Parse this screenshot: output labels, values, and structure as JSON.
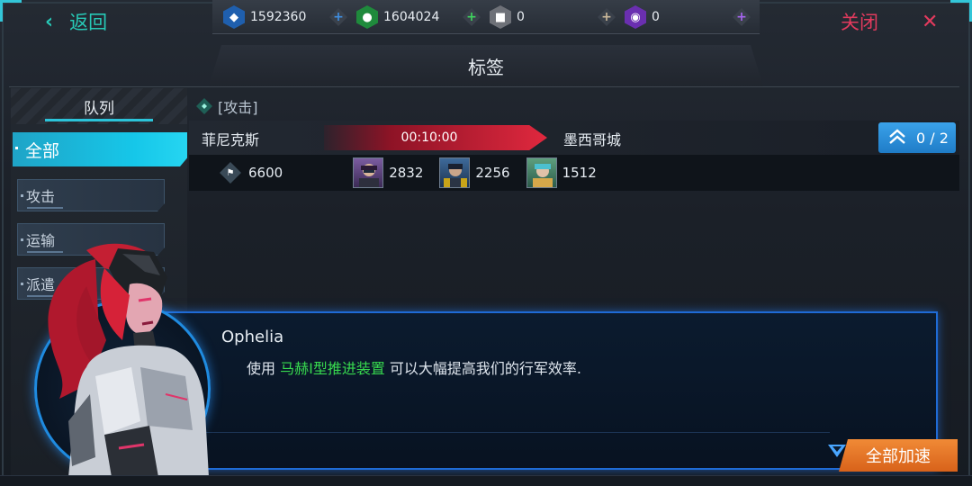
{
  "header": {
    "back_label": "返回",
    "close_label": "关闭",
    "title": "标签"
  },
  "resources": [
    {
      "icon": "crystal-icon",
      "value": "1592360",
      "color": "#2b7bd6"
    },
    {
      "icon": "water-drop-icon",
      "value": "1604024",
      "color": "#27a844"
    },
    {
      "icon": "ore-icon",
      "value": "0",
      "color": "#8b8f96"
    },
    {
      "icon": "gem-icon",
      "value": "0",
      "color": "#8a3ed6"
    }
  ],
  "sidebar": {
    "header": "队列",
    "items": [
      {
        "label": "全部",
        "active": true
      },
      {
        "label": "攻击",
        "active": false
      },
      {
        "label": "运输",
        "active": false
      },
      {
        "label": "派遣",
        "active": false
      }
    ]
  },
  "queue": {
    "tag_label": "[攻击]",
    "origin": "菲尼克斯",
    "destination": "墨西哥城",
    "timer": "00:10:00",
    "speedup_count": "0 / 2",
    "troops": "6600",
    "heroes": [
      {
        "value": "2832",
        "color": "#6a4a8a"
      },
      {
        "value": "2256",
        "color": "#3e5f8a"
      },
      {
        "value": "1512",
        "color": "#4f8a6a"
      }
    ]
  },
  "dialog": {
    "speaker": "Ophelia",
    "message_prefix": "使用 ",
    "message_highlight": "马赫I型推进装置",
    "message_suffix": " 可以大幅提高我们的行军效率."
  },
  "actions": {
    "speed_all_label": "全部加速"
  },
  "colors": {
    "accent_cyan": "#16c7e9",
    "back_green": "#27c9b6",
    "close_red": "#e23a5d",
    "timer_red": "#e0283e",
    "dialog_blue": "#1f6bd6",
    "highlight_green": "#37d94e",
    "orange_button": "#e27224"
  }
}
